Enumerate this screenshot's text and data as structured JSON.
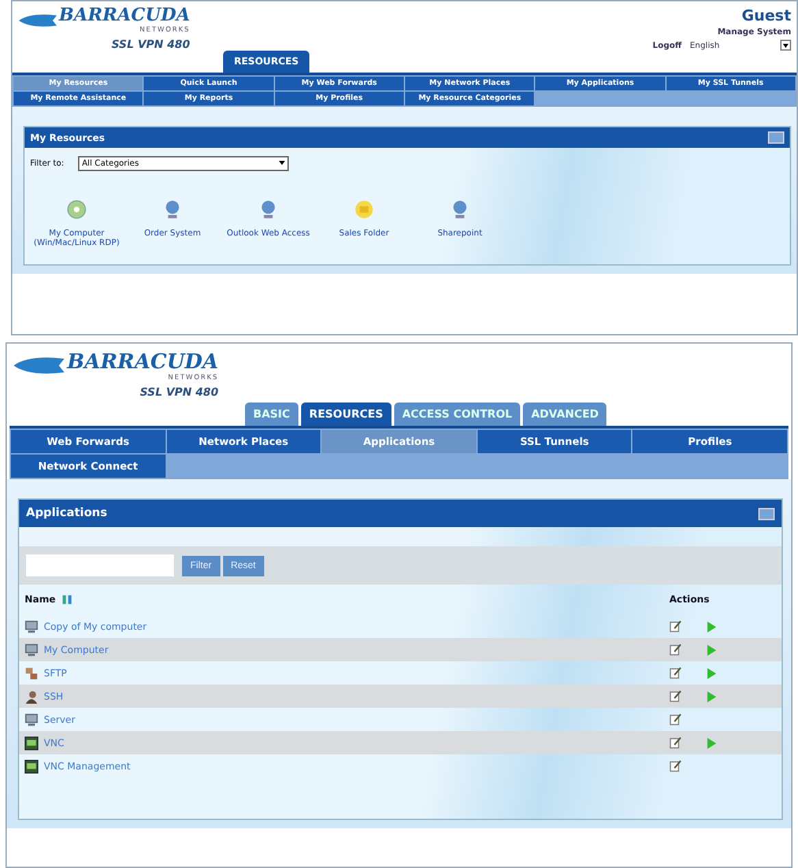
{
  "screen_1": {
    "logo": {
      "brand": "BARRACUDA",
      "sub": "NETWORKS",
      "product": "SSL VPN 480"
    },
    "tabs": [
      {
        "label": "RESOURCES",
        "selected": true
      }
    ],
    "user": {
      "name": "Guest",
      "manage": "Manage System",
      "logoff": "Logoff",
      "language": "English"
    },
    "nav": [
      {
        "label": "My Resources",
        "selected": true
      },
      {
        "label": "Quick Launch",
        "selected": false
      },
      {
        "label": "My Web Forwards",
        "selected": false
      },
      {
        "label": "My Network Places",
        "selected": false
      },
      {
        "label": "My Applications",
        "selected": false
      },
      {
        "label": "My SSL Tunnels",
        "selected": false
      },
      {
        "label": "My Remote Assistance",
        "selected": false
      },
      {
        "label": "My Reports",
        "selected": false
      },
      {
        "label": "My Profiles",
        "selected": false
      },
      {
        "label": "My Resource Categories",
        "selected": false
      }
    ],
    "panel": {
      "title": "My Resources",
      "filter_label": "Filter to:",
      "filter_value": "All Categories",
      "resources": [
        {
          "label": "My Computer (Win/Mac/Linux RDP)",
          "kind": "computer"
        },
        {
          "label": "Order System",
          "kind": "globe"
        },
        {
          "label": "Outlook Web Access",
          "kind": "globe"
        },
        {
          "label": "Sales Folder",
          "kind": "folder"
        },
        {
          "label": "Sharepoint",
          "kind": "globe"
        }
      ]
    }
  },
  "screen_2": {
    "logo": {
      "brand": "BARRACUDA",
      "sub": "NETWORKS",
      "product": "SSL VPN 480"
    },
    "tabs": [
      {
        "label": "BASIC",
        "selected": false
      },
      {
        "label": "RESOURCES",
        "selected": true
      },
      {
        "label": "ACCESS CONTROL",
        "selected": false
      },
      {
        "label": "ADVANCED",
        "selected": false
      }
    ],
    "nav": [
      {
        "label": "Web Forwards",
        "selected": false
      },
      {
        "label": "Network Places",
        "selected": false
      },
      {
        "label": "Applications",
        "selected": true
      },
      {
        "label": "SSL Tunnels",
        "selected": false
      },
      {
        "label": "Profiles",
        "selected": false
      },
      {
        "label": "Network Connect",
        "selected": false
      }
    ],
    "panel": {
      "title": "Applications",
      "buttons": [
        "Filter",
        "Reset"
      ],
      "columns": [
        "Name",
        "Actions"
      ],
      "rows": [
        {
          "name": "Copy of My computer",
          "kind": "terminal",
          "runnable": true
        },
        {
          "name": "My Computer",
          "kind": "terminal",
          "runnable": true
        },
        {
          "name": "SFTP",
          "kind": "transfer",
          "runnable": true
        },
        {
          "name": "SSH",
          "kind": "user",
          "runnable": true
        },
        {
          "name": "Server",
          "kind": "terminal",
          "runnable": false
        },
        {
          "name": "VNC",
          "kind": "vnc",
          "runnable": true
        },
        {
          "name": "VNC Management",
          "kind": "vnc",
          "runnable": false
        }
      ]
    }
  }
}
